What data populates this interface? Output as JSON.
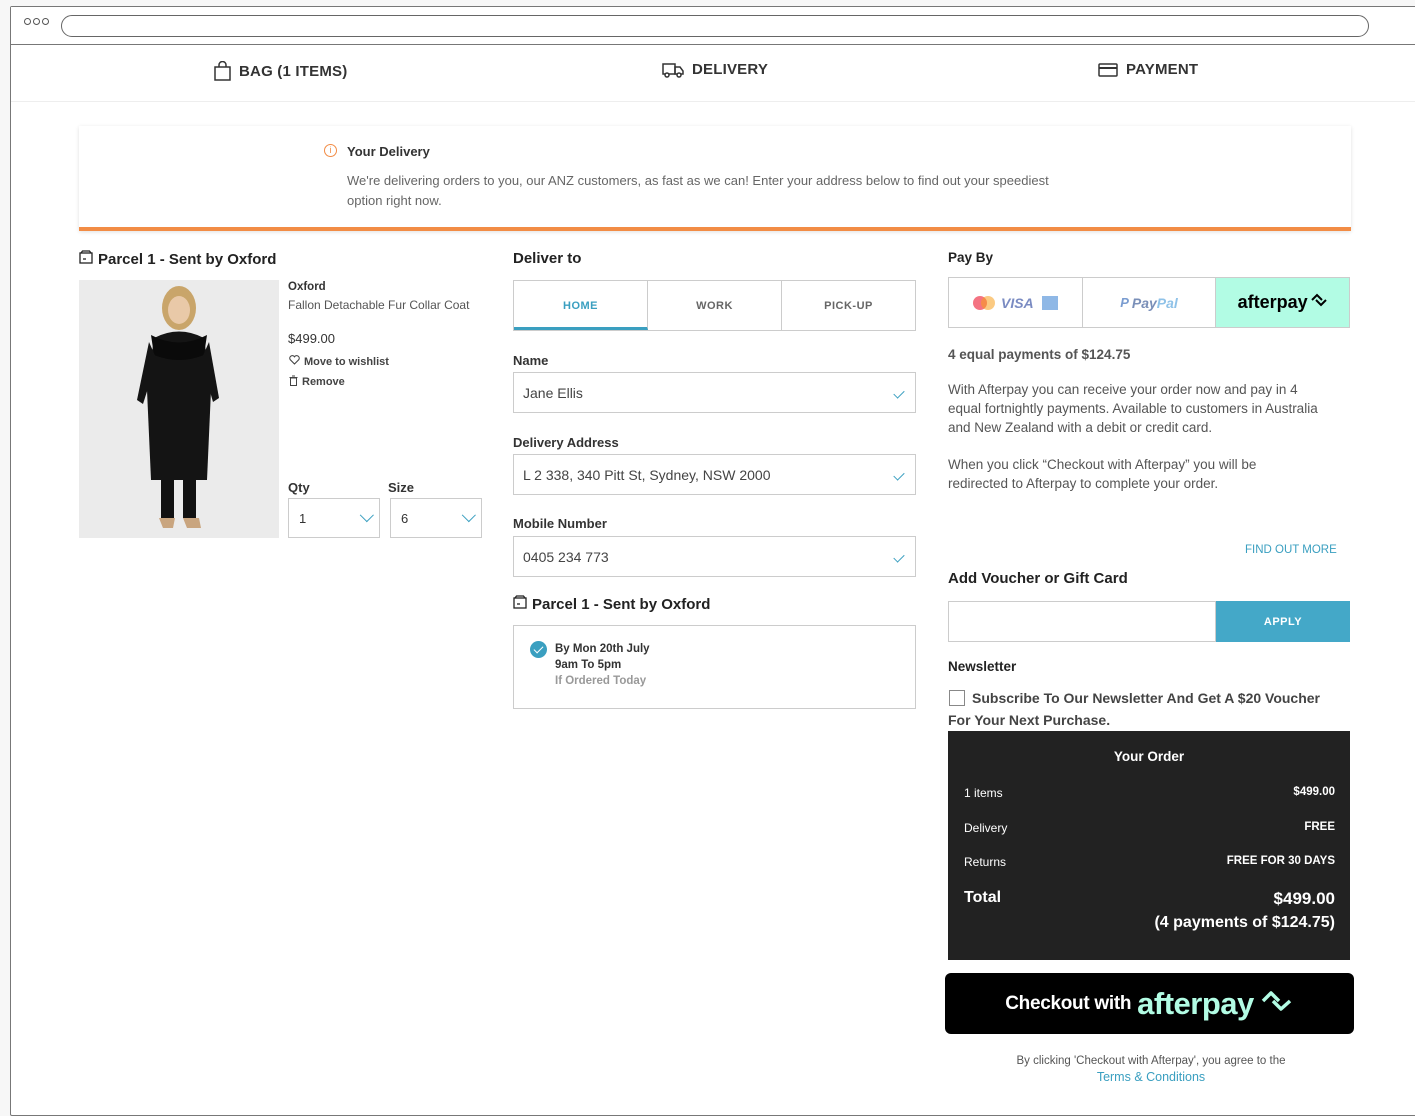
{
  "steps": {
    "bag": "BAG (1 ITEMS)",
    "delivery": "DELIVERY",
    "payment": "PAYMENT"
  },
  "banner": {
    "title": "Your Delivery",
    "text": "We're delivering orders to you, our ANZ customers, as fast as we can! Enter your address below to find out your speediest option right now."
  },
  "parcel": {
    "title": "Parcel 1 - Sent by Oxford",
    "brand": "Oxford",
    "name": "Fallon Detachable Fur Collar Coat",
    "price": "$499.00",
    "wishlist": "Move to wishlist",
    "remove": "Remove",
    "qty_label": "Qty",
    "qty_value": "1",
    "size_label": "Size",
    "size_value": "6"
  },
  "deliver": {
    "title": "Deliver to",
    "tabs": [
      "HOME",
      "WORK",
      "PICK-UP"
    ],
    "name_label": "Name",
    "name_value": "Jane Ellis",
    "address_label": "Delivery Address",
    "address_value": "L 2 338, 340 Pitt St, Sydney, NSW 2000",
    "mobile_label": "Mobile Number",
    "mobile_value": "0405 234 773",
    "parcel_title": "Parcel 1 - Sent by Oxford",
    "option_date": "By Mon 20th July",
    "option_time": "9am To 5pm",
    "option_note": "If Ordered Today"
  },
  "payment": {
    "title": "Pay By",
    "visa": "VISA",
    "paypal_a": "Pay",
    "paypal_b": "Pal",
    "afterpay_logo": "afterpay",
    "equal_payments": "4 equal payments of $124.75",
    "desc1": "With Afterpay you can receive your order now and pay in 4 equal fortnightly payments. Available to customers in Australia and New Zealand with a debit or credit card.",
    "desc2": "When you click “Checkout with Afterpay” you will be redirected to Afterpay to complete your order.",
    "find_out_more": "FIND OUT MORE",
    "voucher_title": "Add Voucher or Gift Card",
    "apply": "APPLY",
    "newsletter_title": "Newsletter",
    "newsletter_text": "Subscribe To Our Newsletter And Get A $20 Voucher For Your Next Purchase."
  },
  "order": {
    "title": "Your Order",
    "items_label": "1 items",
    "items_value": "$499.00",
    "delivery_label": "Delivery",
    "delivery_value": "FREE",
    "returns_label": "Returns",
    "returns_value": "FREE FOR 30 DAYS",
    "total_label": "Total",
    "total_value": "$499.00",
    "installments": "(4 payments of $124.75)"
  },
  "checkout": {
    "label": "Checkout with",
    "logo": "afterpay"
  },
  "legal": {
    "text": "By clicking 'Checkout with Afterpay', you agree to the",
    "link": "Terms & Conditions"
  },
  "colors": {
    "accent": "#3a9fc0",
    "orange": "#f28c45",
    "afterpay_mint": "#b2fce4",
    "dark": "#222222"
  }
}
